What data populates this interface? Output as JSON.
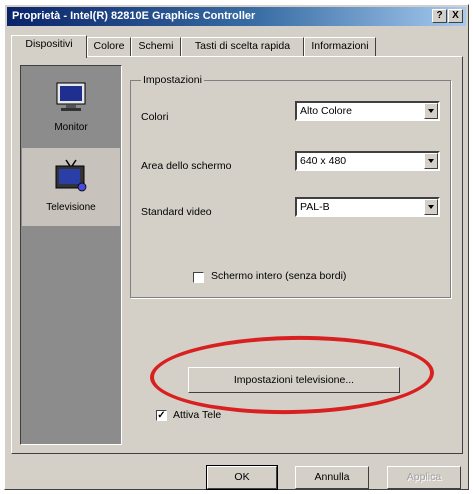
{
  "window": {
    "title": "Proprietà - Intel(R) 82810E Graphics Controller",
    "help_label": "?",
    "close_label": "X"
  },
  "tabs": [
    "Dispositivi",
    "Colore",
    "Schemi",
    "Tasti di scelta rapida",
    "Informazioni"
  ],
  "devices": [
    {
      "label": "Monitor",
      "icon": "monitor-icon"
    },
    {
      "label": "Televisione",
      "icon": "television-icon"
    }
  ],
  "settings": {
    "group_title": "Impostazioni",
    "colori": {
      "label": "Colori",
      "value": "Alto Colore"
    },
    "area": {
      "label": "Area dello schermo",
      "value": "640 x 480"
    },
    "standard": {
      "label": "Standard video",
      "value": "PAL-B"
    },
    "fullscreen": {
      "label": "Schermo intero (senza bordi)",
      "checked": false
    }
  },
  "tv_settings_button": "Impostazioni televisione...",
  "activate": {
    "label": "Attiva Tele",
    "checked": true
  },
  "buttons": {
    "ok": "OK",
    "cancel": "Annulla",
    "apply": "Applica"
  },
  "colors": {
    "title_start": "#0a246a",
    "highlight_ellipse": "#d92020",
    "face": "#d4d0c8"
  }
}
